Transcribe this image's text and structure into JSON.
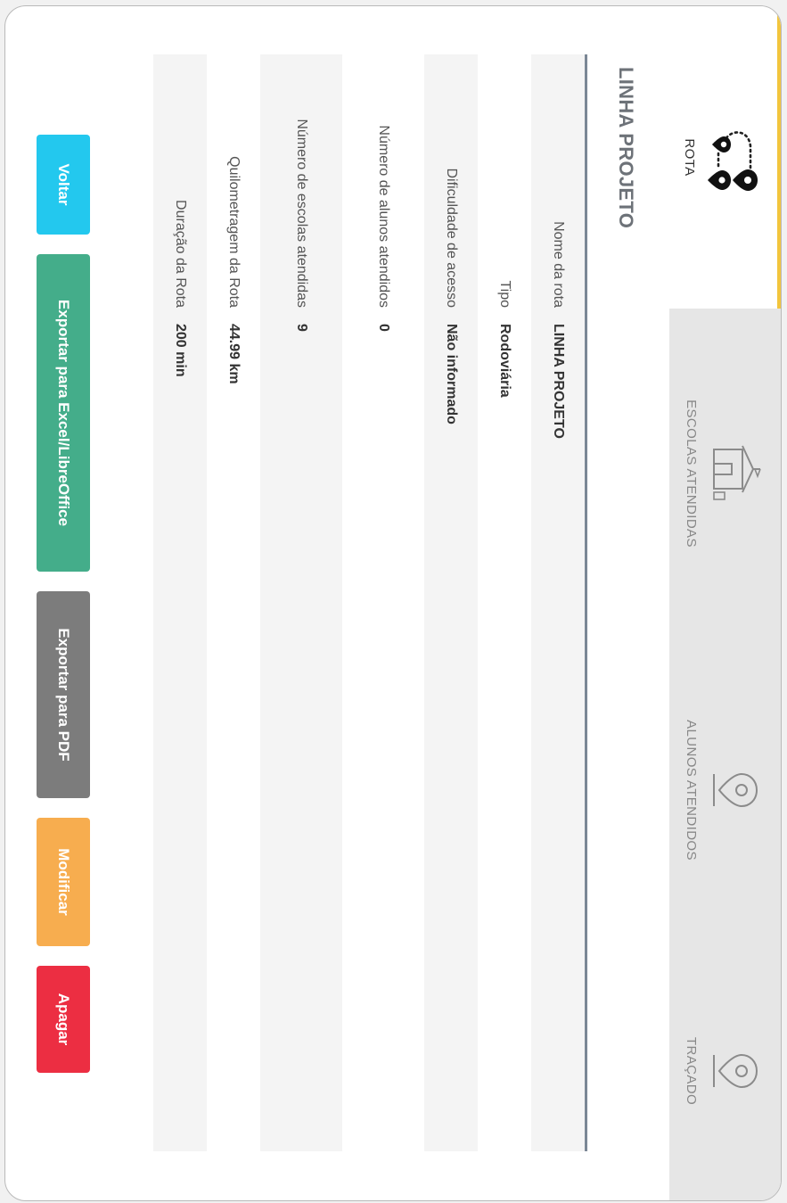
{
  "tabs": [
    {
      "label": "ROTA",
      "icon": "route-icon",
      "active": true
    },
    {
      "label": "ESCOLAS ATENDIDAS",
      "icon": "school-icon",
      "active": false
    },
    {
      "label": "ALUNOS ATENDIDOS",
      "icon": "location-pin-icon",
      "active": false
    },
    {
      "label": "TRAÇADO",
      "icon": "location-pin-icon",
      "active": false
    }
  ],
  "title": "LINHA PROJETO",
  "details": [
    {
      "label": "Nome da rota",
      "value": "LINHA PROJETO"
    },
    {
      "label": "Tipo",
      "value": "Rodoviária"
    },
    {
      "label": "Dificuldade de acesso",
      "value": "Não informado"
    },
    {
      "label": "Número de alunos atendidos",
      "value": "0"
    },
    {
      "label": "Número de escolas atendidas",
      "value": "9"
    },
    {
      "label": "Quilometragem da Rota",
      "value": "44.99 km"
    },
    {
      "label": "Duração da Rota",
      "value": "200 min"
    }
  ],
  "buttons": {
    "back": "Voltar",
    "export_excel": "Exportar para Excel/LibreOffice",
    "export_pdf": "Exportar para PDF",
    "modify": "Modificar",
    "delete": "Apagar"
  },
  "colors": {
    "tab_active_accent": "#f2c53d",
    "table_border": "#7b8795",
    "back": "#23c8ee",
    "excel": "#44ad8a",
    "pdf": "#7c7c7c",
    "modify": "#f7ad4f",
    "delete": "#ec2e42"
  }
}
